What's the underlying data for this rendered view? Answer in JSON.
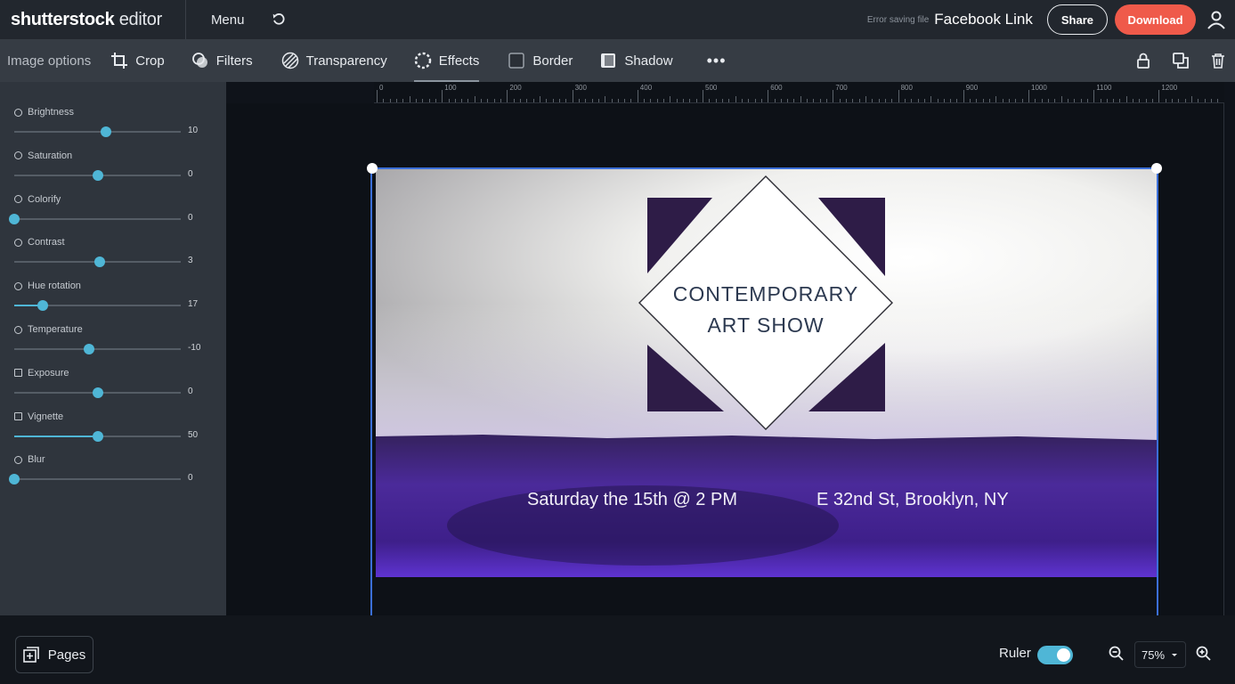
{
  "app": {
    "logo_bold": "shutterstock",
    "logo_light": "editor",
    "menu_label": "Menu",
    "error_text": "Error saving file",
    "doc_title": "Facebook Link",
    "share_label": "Share",
    "download_label": "Download"
  },
  "toolbar": {
    "section_label": "Image options",
    "tools": [
      {
        "label": "Crop",
        "icon": "crop-icon"
      },
      {
        "label": "Filters",
        "icon": "filters-icon"
      },
      {
        "label": "Transparency",
        "icon": "transparency-icon"
      },
      {
        "label": "Effects",
        "icon": "effects-icon",
        "active": true
      },
      {
        "label": "Border",
        "icon": "border-icon"
      },
      {
        "label": "Shadow",
        "icon": "shadow-icon"
      }
    ],
    "more_label": "•••"
  },
  "adjustments": [
    {
      "label": "Brightness",
      "value": "10",
      "level": 0.55,
      "filled": false
    },
    {
      "label": "Saturation",
      "value": "0",
      "level": 0.5,
      "filled": false
    },
    {
      "label": "Colorify",
      "value": "0",
      "level": 0.0,
      "filled": false
    },
    {
      "label": "Contrast",
      "value": "3",
      "level": 0.515,
      "filled": false
    },
    {
      "label": "Hue rotation",
      "value": "17",
      "level": 0.17,
      "filled": true
    },
    {
      "label": "Temperature",
      "value": "-10",
      "level": 0.45,
      "filled": false
    },
    {
      "label": "Exposure",
      "value": "0",
      "level": 0.5,
      "filled": false
    },
    {
      "label": "Vignette",
      "value": "50",
      "level": 0.5,
      "filled": true
    },
    {
      "label": "Blur",
      "value": "0",
      "level": 0.0,
      "filled": false
    }
  ],
  "ruler_ticks": [
    "0",
    "100",
    "200",
    "300",
    "400",
    "500",
    "600",
    "700",
    "800",
    "900",
    "1000",
    "1100",
    "1200"
  ],
  "design": {
    "title_line1": "CONTEMPORARY",
    "title_line2": "ART SHOW",
    "date_text": "Saturday the 15th @ 2 PM",
    "location_text": "E 32nd St, Brooklyn, NY"
  },
  "bottom": {
    "pages_label": "Pages",
    "ruler_label": "Ruler",
    "ruler_on": true,
    "zoom": "75%"
  },
  "colors": {
    "accent": "#4fb6d6",
    "download": "#ef5a4a",
    "purple_dark": "#2e1c47",
    "purple_paint": "#4a23a0"
  }
}
